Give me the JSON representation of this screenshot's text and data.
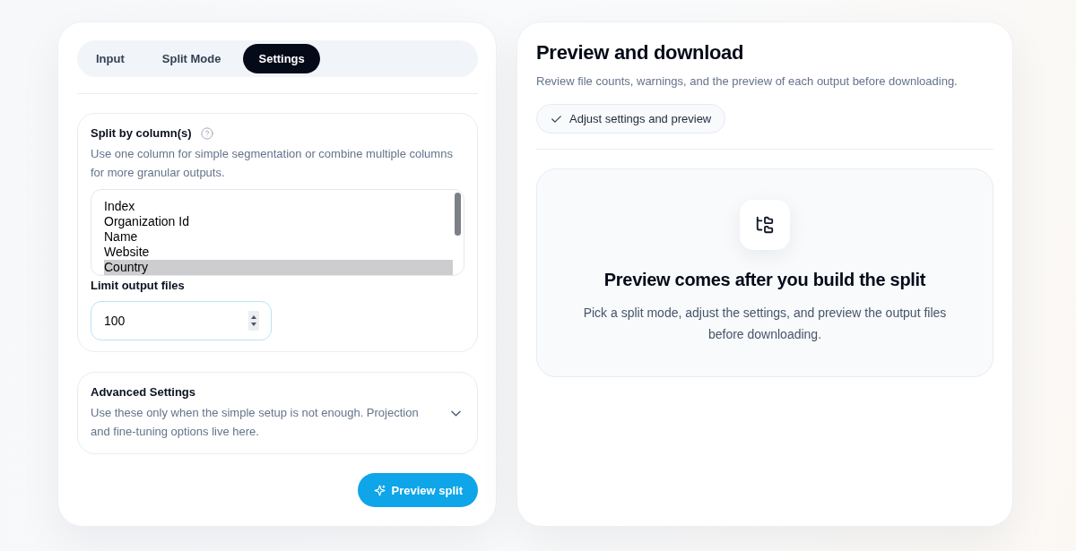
{
  "tabs": [
    {
      "label": "Input",
      "selected": false
    },
    {
      "label": "Split Mode",
      "selected": false
    },
    {
      "label": "Settings",
      "selected": true
    }
  ],
  "split_section": {
    "title": "Split by column(s)",
    "description": "Use one column for simple segmentation or combine multiple columns for more granular outputs.",
    "columns": [
      {
        "label": "Index",
        "selected": false
      },
      {
        "label": "Organization Id",
        "selected": false
      },
      {
        "label": "Name",
        "selected": false
      },
      {
        "label": "Website",
        "selected": false
      },
      {
        "label": "Country",
        "selected": true
      }
    ]
  },
  "limit_field": {
    "label": "Limit output files",
    "value": "100"
  },
  "advanced_section": {
    "title": "Advanced Settings",
    "description": "Use these only when the simple setup is not enough. Projection and fine-tuning options live here.",
    "expanded": false
  },
  "preview_button": {
    "label": "Preview split"
  },
  "preview_panel": {
    "title": "Preview and download",
    "description": "Review file counts, warnings, and the preview of each output before downloading.",
    "status_chip": {
      "label": "Adjust settings and preview"
    },
    "empty_state": {
      "title": "Preview comes after you build the split",
      "description": "Pick a split mode, adjust the settings, and preview the output files before downloading."
    }
  }
}
